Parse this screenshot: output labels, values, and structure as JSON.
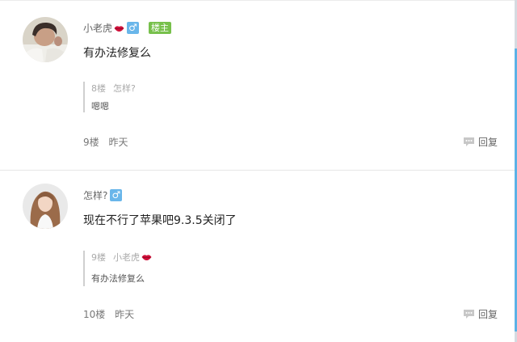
{
  "posts": [
    {
      "username": "小老虎",
      "gender_icon": "male-symbol",
      "badge": "楼主",
      "content": "有办法修复么",
      "quote": {
        "floor": "8楼",
        "author": "怎样?",
        "text": "嗯嗯"
      },
      "floor": "9楼",
      "time": "昨天",
      "reply_label": "回复"
    },
    {
      "username": "怎样?",
      "gender_icon": "male-symbol",
      "content": "现在不行了苹果吧9.3.5关闭了",
      "quote": {
        "floor": "9楼",
        "author": "小老虎",
        "text": "有办法修复么"
      },
      "floor": "10楼",
      "time": "昨天",
      "reply_label": "回复"
    }
  ],
  "colors": {
    "gender_badge": "#69b6ea",
    "op_badge": "#77c04b",
    "scroll_accent": "#5cb2e6",
    "lips": "#d0103a"
  }
}
